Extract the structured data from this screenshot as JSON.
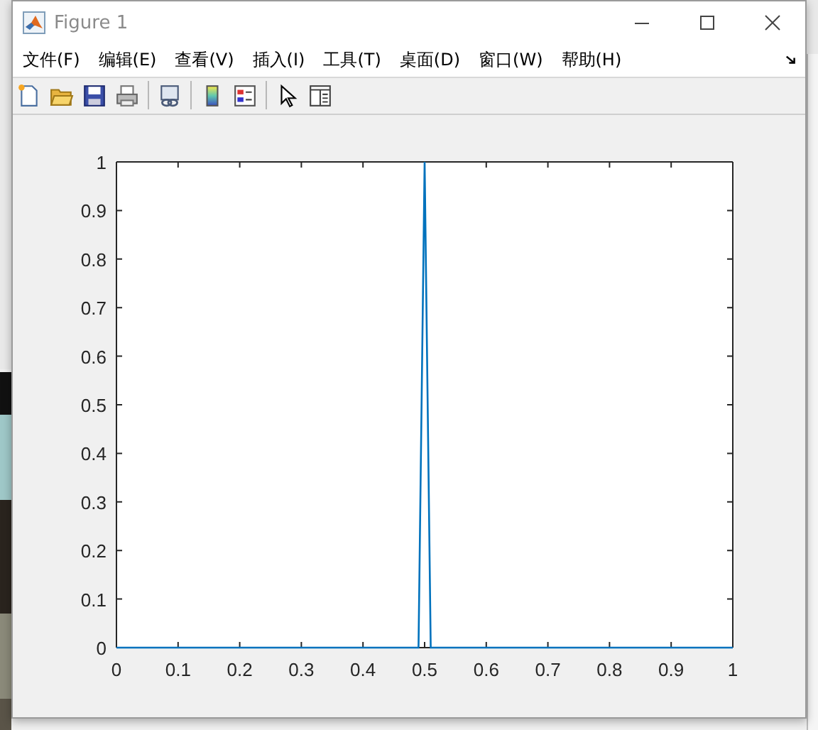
{
  "window": {
    "title": "Figure 1"
  },
  "menu": [
    {
      "label": "文件(F)"
    },
    {
      "label": "编辑(E)"
    },
    {
      "label": "查看(V)"
    },
    {
      "label": "插入(I)"
    },
    {
      "label": "工具(T)"
    },
    {
      "label": "桌面(D)"
    },
    {
      "label": "窗口(W)"
    },
    {
      "label": "帮助(H)"
    }
  ],
  "toolbar": [
    {
      "kind": "new"
    },
    {
      "kind": "open"
    },
    {
      "kind": "save"
    },
    {
      "kind": "print"
    },
    {
      "kind": "sep"
    },
    {
      "kind": "link"
    },
    {
      "kind": "sep"
    },
    {
      "kind": "colorbar"
    },
    {
      "kind": "legend"
    },
    {
      "kind": "sep"
    },
    {
      "kind": "pointer"
    },
    {
      "kind": "property"
    }
  ],
  "plot": {
    "chart_data": {
      "type": "line",
      "x": [
        0,
        0.49,
        0.5,
        0.51,
        1
      ],
      "series": [
        {
          "color": "#0072bd",
          "values": [
            0,
            0,
            1,
            0,
            0
          ]
        }
      ],
      "xlim": [
        0,
        1
      ],
      "ylim": [
        0,
        1
      ],
      "xticks": [
        {
          "value": 0,
          "label": "0"
        },
        {
          "value": 0.1,
          "label": "0.1"
        },
        {
          "value": 0.2,
          "label": "0.2"
        },
        {
          "value": 0.3,
          "label": "0.3"
        },
        {
          "value": 0.4,
          "label": "0.4"
        },
        {
          "value": 0.5,
          "label": "0.5"
        },
        {
          "value": 0.6,
          "label": "0.6"
        },
        {
          "value": 0.7,
          "label": "0.7"
        },
        {
          "value": 0.8,
          "label": "0.8"
        },
        {
          "value": 0.9,
          "label": "0.9"
        },
        {
          "value": 1,
          "label": "1"
        }
      ],
      "yticks": [
        {
          "value": 0,
          "label": "0"
        },
        {
          "value": 0.1,
          "label": "0.1"
        },
        {
          "value": 0.2,
          "label": "0.2"
        },
        {
          "value": 0.3,
          "label": "0.3"
        },
        {
          "value": 0.4,
          "label": "0.4"
        },
        {
          "value": 0.5,
          "label": "0.5"
        },
        {
          "value": 0.6,
          "label": "0.6"
        },
        {
          "value": 0.7,
          "label": "0.7"
        },
        {
          "value": 0.8,
          "label": "0.8"
        },
        {
          "value": 0.9,
          "label": "0.9"
        },
        {
          "value": 1,
          "label": "1"
        }
      ]
    }
  }
}
